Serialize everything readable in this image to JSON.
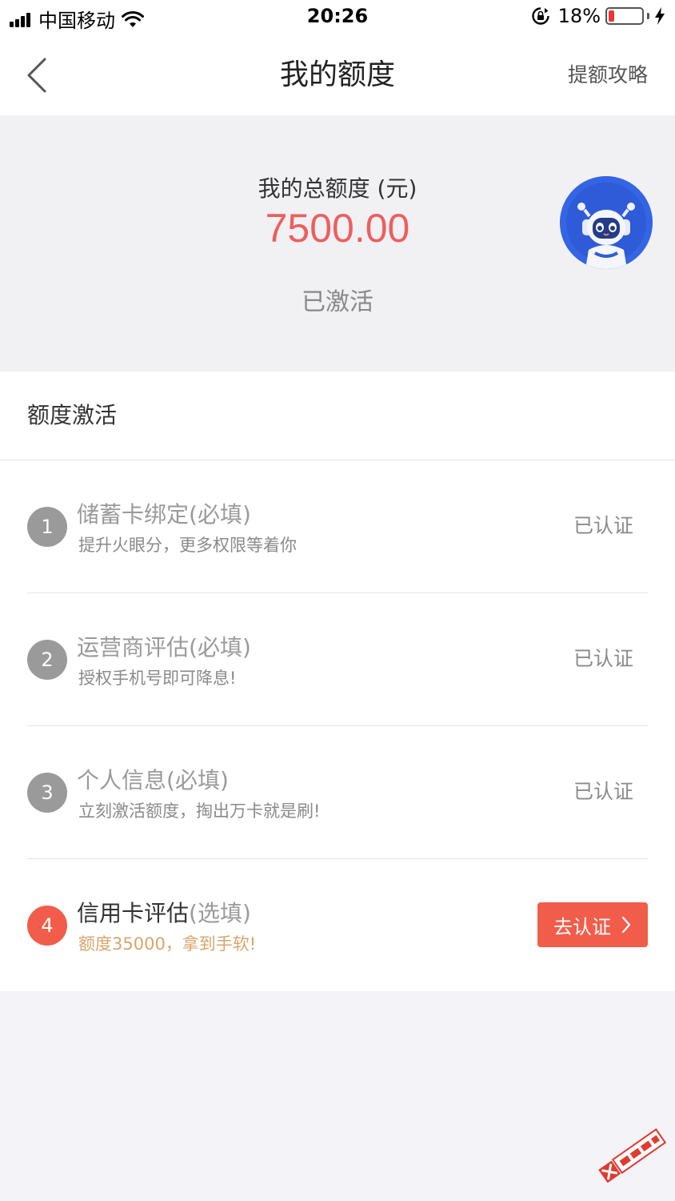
{
  "status_bar": {
    "carrier": "中国移动",
    "time": "20:26",
    "battery_percent": "18%",
    "battery_level": 0.18,
    "icons": [
      "signal-icon",
      "wifi-icon",
      "rotation-lock-icon",
      "battery-icon",
      "charging-icon"
    ]
  },
  "nav": {
    "title": "我的额度",
    "action": "提额攻略",
    "back_icon": "chevron-left-icon"
  },
  "credit": {
    "label": "我的总额度 (元)",
    "amount": "7500.00",
    "status": "已激活",
    "avatar_icon": "robot-avatar-icon"
  },
  "activation": {
    "title": "额度激活",
    "steps": [
      {
        "number": "1",
        "title": "储蓄卡绑定",
        "suffix": "(必填)",
        "desc": "提升火眼分，更多权限等着你",
        "state": "已认证"
      },
      {
        "number": "2",
        "title": "运营商评估",
        "suffix": "(必填)",
        "desc": "授权手机号即可降息!",
        "state": "已认证"
      },
      {
        "number": "3",
        "title": "个人信息",
        "suffix": "(必填)",
        "desc": "立刻激活额度，掏出万卡就是刷!",
        "state": "已认证"
      },
      {
        "number": "4",
        "title": "信用卡评估",
        "suffix": "(选填)",
        "desc": "额度35000，拿到手软!",
        "button": "去认证"
      }
    ]
  },
  "colors": {
    "accent": "#f15d4a",
    "amount": "#ec5f5f",
    "highlight": "#d9a46b",
    "muted": "#9a9a9a",
    "header_bg": "#f1f1f4"
  }
}
